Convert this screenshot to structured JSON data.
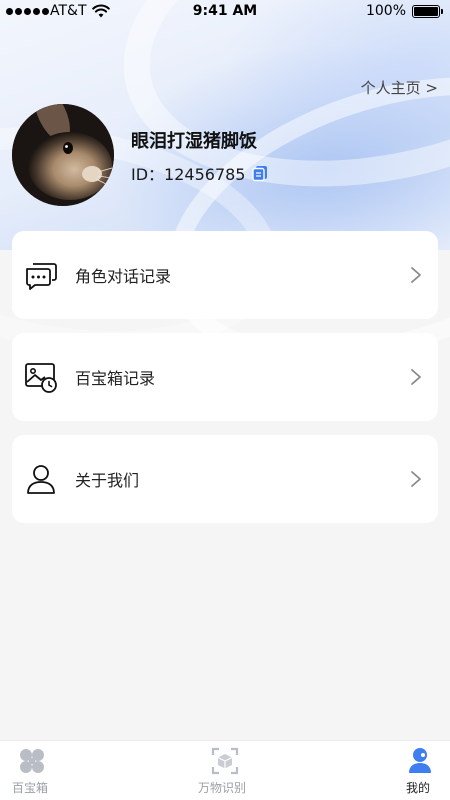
{
  "status_bar": {
    "carrier": "AT&T",
    "time": "9:41 AM",
    "battery": "100%",
    "battery_level": 1.0
  },
  "header": {
    "profile_link": "个人主页 >",
    "username": "眼泪打湿猪脚饭",
    "user_id": "ID：12456785"
  },
  "menu": {
    "items": [
      {
        "label": "角色对话记录",
        "icon": "chat-bubbles-icon"
      },
      {
        "label": "百宝箱记录",
        "icon": "image-clock-icon"
      },
      {
        "label": "关于我们",
        "icon": "user-icon"
      }
    ]
  },
  "tabbar": {
    "items": [
      {
        "label": "百宝箱",
        "icon": "clover-icon",
        "active": false
      },
      {
        "label": "万物识别",
        "icon": "scan-box-icon",
        "active": false
      },
      {
        "label": "我的",
        "icon": "person-icon",
        "active": true
      }
    ],
    "active_color": "#3f7ef0",
    "inactive_color": "#9aa0a8"
  },
  "colors": {
    "accent": "#3f7ef0",
    "background": "#f5f5f6"
  }
}
